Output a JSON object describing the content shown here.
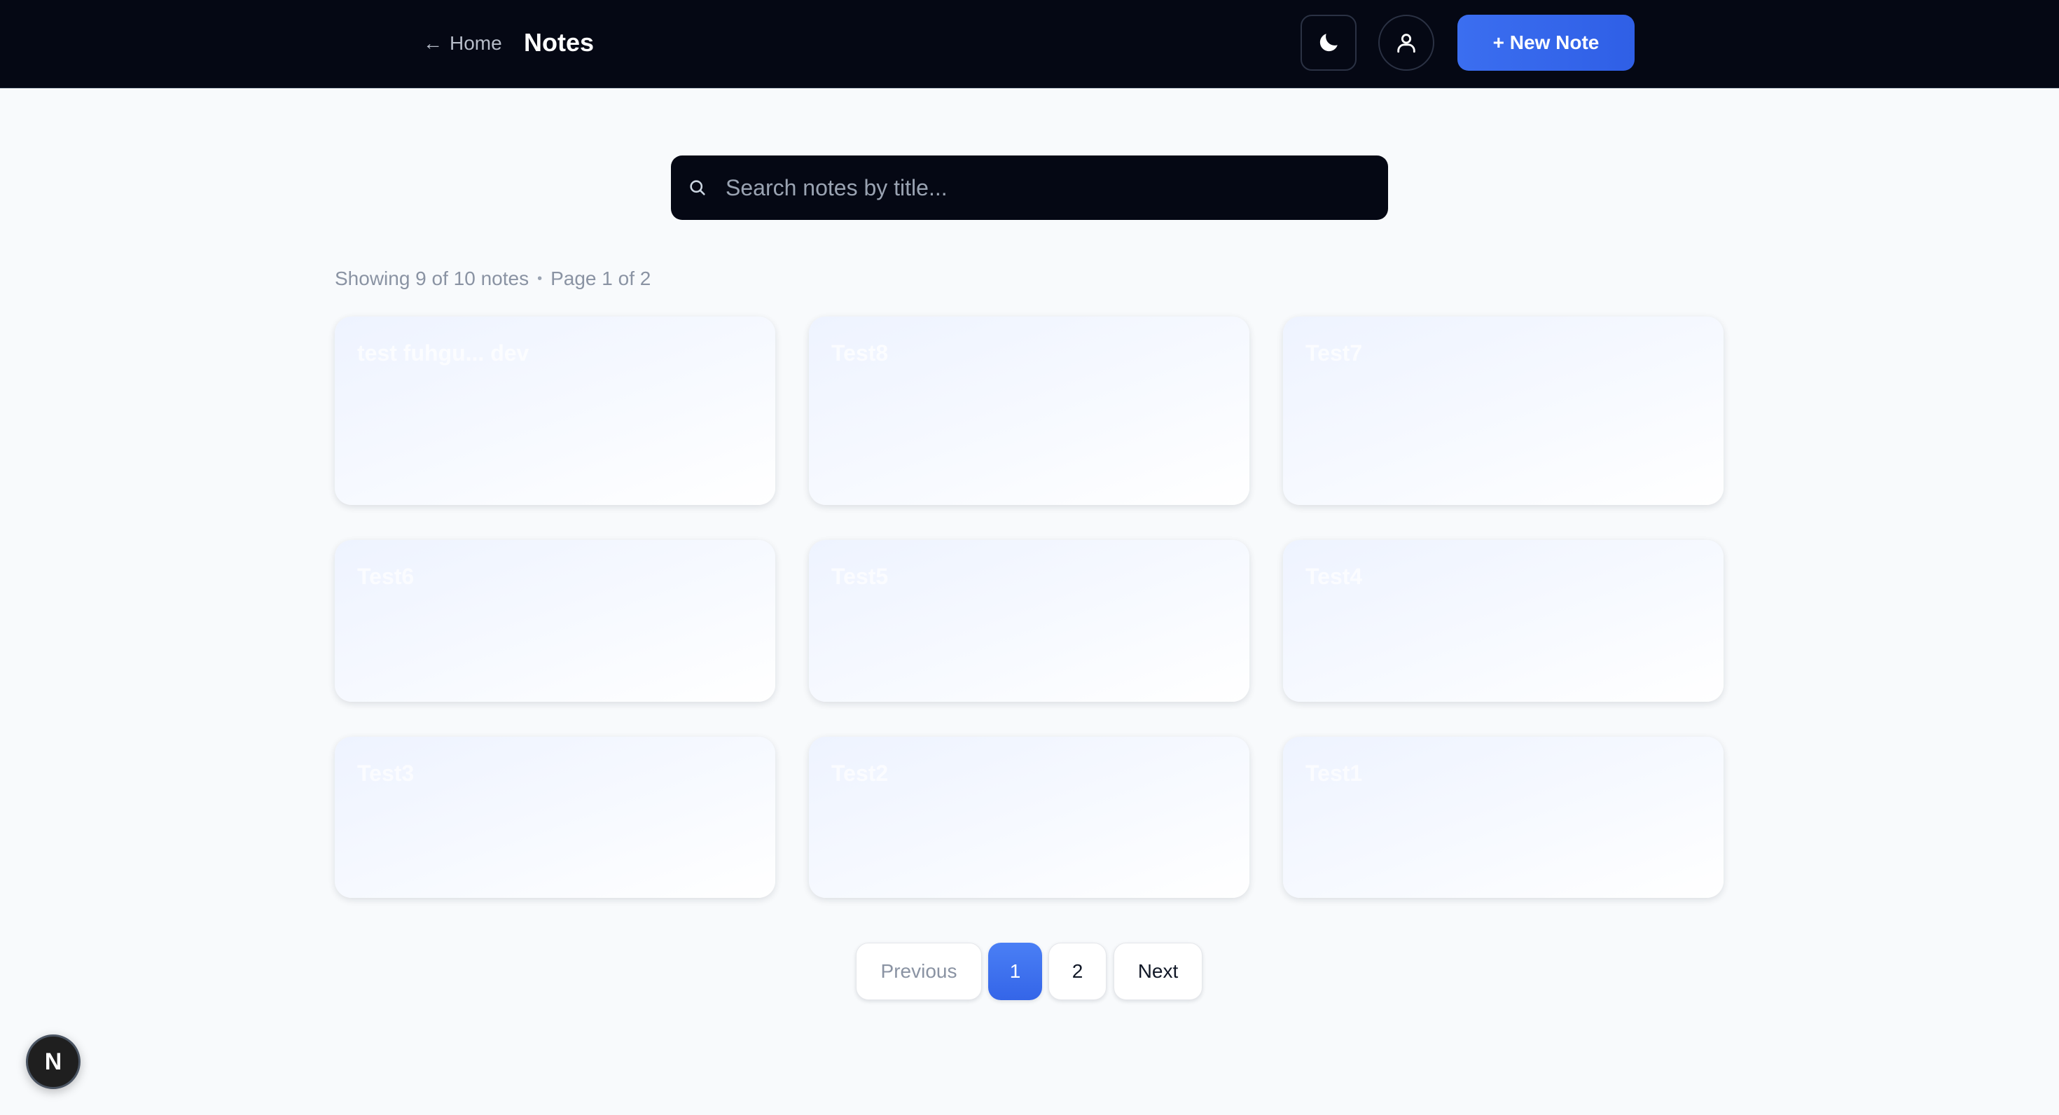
{
  "header": {
    "home_label": "Home",
    "title": "Notes",
    "new_note_label": "+ New Note"
  },
  "icons": {
    "back": "arrow-left-icon",
    "theme": "moon-icon",
    "user": "user-icon",
    "search": "search-icon"
  },
  "search": {
    "placeholder": "Search notes by title...",
    "value": ""
  },
  "summary": {
    "showing": "Showing 9 of 10 notes",
    "separator": "•",
    "page": "Page 1 of 2"
  },
  "notes": [
    {
      "title": "test fuhgu... dev",
      "preview": ""
    },
    {
      "title": "Test8",
      "preview": ""
    },
    {
      "title": "Test7",
      "preview": ""
    },
    {
      "title": "Test6",
      "preview": ""
    },
    {
      "title": "Test5",
      "preview": ""
    },
    {
      "title": "Test4",
      "preview": ""
    },
    {
      "title": "Test3",
      "preview": ""
    },
    {
      "title": "Test2",
      "preview": ""
    },
    {
      "title": "Test1",
      "preview": ""
    }
  ],
  "pagination": {
    "previous": "Previous",
    "pages": [
      "1",
      "2"
    ],
    "current": "1",
    "next": "Next"
  },
  "badge": {
    "label": "N"
  },
  "colors": {
    "header_bg": "#050814",
    "accent": "#3b6ef0",
    "page_bg": "#f8fafc"
  }
}
